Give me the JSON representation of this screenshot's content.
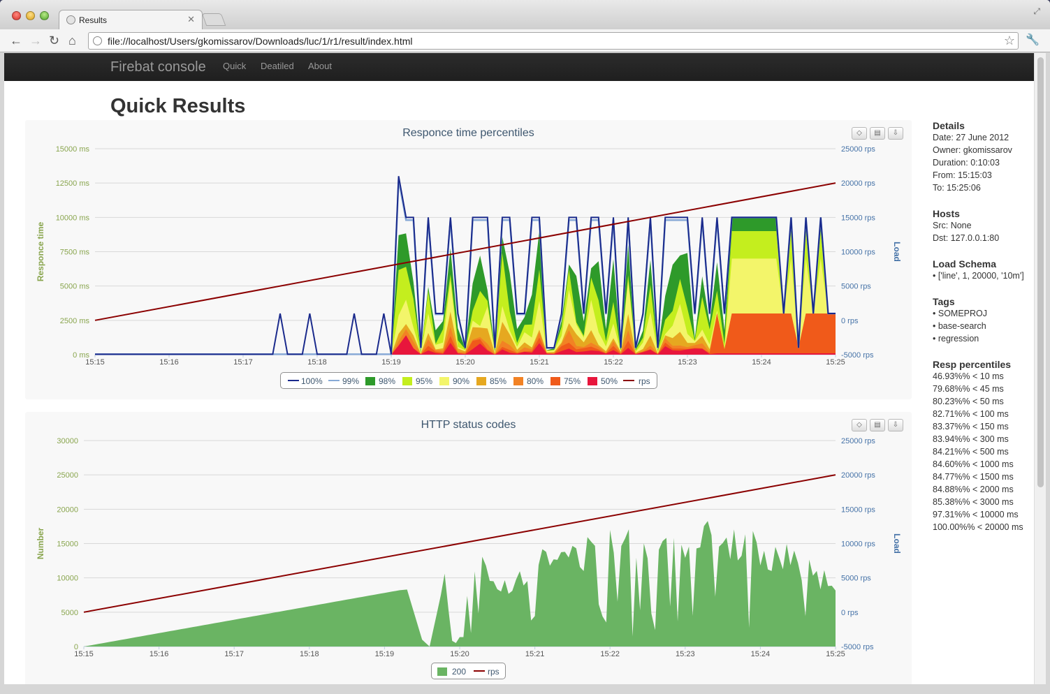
{
  "browser": {
    "tab_title": "Results",
    "url": "file://localhost/Users/gkomissarov/Downloads/luc/1/r1/result/index.html"
  },
  "navbar": {
    "brand": "Firebat console",
    "links": [
      "Quick",
      "Deatiled",
      "About"
    ]
  },
  "page": {
    "title": "Quick Results"
  },
  "sidebar": {
    "details": {
      "heading": "Details",
      "lines": [
        "Date: 27 June 2012",
        "Owner: gkomissarov",
        "Duration: 0:10:03",
        "From: 15:15:03",
        "To: 15:25:06"
      ]
    },
    "hosts": {
      "heading": "Hosts",
      "lines": [
        "Src: None",
        "Dst: 127.0.0.1:80"
      ]
    },
    "load_schema": {
      "heading": "Load Schema",
      "items": [
        "['line', 1, 20000, '10m']"
      ]
    },
    "tags": {
      "heading": "Tags",
      "items": [
        "SOMEPROJ",
        "base-search",
        "regression"
      ]
    },
    "resp_percentiles": {
      "heading": "Resp percentiles",
      "lines": [
        "46.93%% < 10 ms",
        "79.68%% < 45 ms",
        "80.23%% < 50 ms",
        "82.71%% < 100 ms",
        "83.37%% < 150 ms",
        "83.94%% < 300 ms",
        "84.21%% < 500 ms",
        "84.60%% < 1000 ms",
        "84.77%% < 1500 ms",
        "84.88%% < 2000 ms",
        "85.38%% < 3000 ms",
        "97.31%% < 10000 ms",
        "100.00%% < 20000 ms"
      ]
    }
  },
  "chart_data": [
    {
      "type": "area",
      "title": "Responce time percentiles",
      "ylabel": "Responce time",
      "y2label": "Load",
      "ylim": [
        0,
        15000
      ],
      "y2lim": [
        -5000,
        25000
      ],
      "y_ticks": [
        "0 ms",
        "2500 ms",
        "5000 ms",
        "7500 ms",
        "10000 ms",
        "12500 ms",
        "15000 ms"
      ],
      "y2_ticks": [
        "-5000 rps",
        "0 rps",
        "5000 rps",
        "10000 rps",
        "15000 rps",
        "20000 rps",
        "25000 rps"
      ],
      "x_ticks": [
        "15:15",
        "15:16",
        "15:17",
        "15:18",
        "15:19",
        "15:20",
        "15:21",
        "15:22",
        "15:23",
        "15:24",
        "15:25"
      ],
      "legend": [
        "100%",
        "99%",
        "98%",
        "95%",
        "90%",
        "85%",
        "80%",
        "75%",
        "50%",
        "rps"
      ],
      "colors": {
        "100%": "#1a2a8c",
        "99%": "#87a9d6",
        "98%": "#2e9a2a",
        "95%": "#c4ee1e",
        "90%": "#f3f56a",
        "85%": "#e6a820",
        "80%": "#f28224",
        "75%": "#f05a1a",
        "50%": "#e8163c",
        "rps": "#8b0000"
      },
      "series": [
        {
          "name": "100%",
          "points": [
            [
              0,
              0
            ],
            [
              0.5,
              0
            ],
            [
              1,
              0
            ],
            [
              2,
              0
            ],
            [
              2.4,
              0
            ],
            [
              2.5,
              0
            ],
            [
              2.6,
              0
            ],
            [
              2.7,
              0
            ],
            [
              2.8,
              0
            ],
            [
              2.9,
              0
            ],
            [
              3.0,
              0
            ],
            [
              3.1,
              0
            ],
            [
              3.2,
              0
            ],
            [
              3.3,
              0
            ],
            [
              3.4,
              0
            ],
            [
              3.5,
              0
            ],
            [
              3.6,
              0
            ],
            [
              3.7,
              0
            ],
            [
              3.8,
              0
            ],
            [
              3.9,
              0
            ],
            [
              4.0,
              0
            ],
            [
              4.1,
              0
            ],
            [
              4.2,
              0
            ],
            [
              4.3,
              0
            ],
            [
              4.4,
              0
            ],
            [
              4.5,
              0
            ],
            [
              4.6,
              0
            ],
            [
              4.7,
              0
            ],
            [
              4.8,
              0
            ],
            [
              4.9,
              0
            ],
            [
              5.0,
              0
            ],
            [
              5.1,
              0
            ],
            [
              5.2,
              0
            ],
            [
              5.3,
              0
            ],
            [
              5.4,
              0
            ],
            [
              5.5,
              0
            ],
            [
              5.6,
              0
            ],
            [
              5.7,
              0
            ],
            [
              5.8,
              0
            ],
            [
              5.9,
              0
            ],
            [
              6.0,
              0
            ],
            [
              6.1,
              0
            ],
            [
              6.2,
              0
            ],
            [
              6.3,
              0
            ],
            [
              6.4,
              0
            ],
            [
              6.5,
              0
            ],
            [
              6.6,
              0
            ],
            [
              6.7,
              0
            ],
            [
              6.8,
              0
            ],
            [
              6.9,
              0
            ],
            [
              7.0,
              0
            ],
            [
              7.1,
              0
            ],
            [
              7.2,
              0
            ],
            [
              7.3,
              0
            ],
            [
              7.4,
              0
            ],
            [
              7.5,
              0
            ],
            [
              7.6,
              0
            ],
            [
              7.7,
              0
            ],
            [
              7.8,
              0
            ],
            [
              7.9,
              0
            ],
            [
              8.0,
              0
            ],
            [
              8.1,
              0
            ],
            [
              8.2,
              0
            ],
            [
              8.3,
              0
            ],
            [
              8.4,
              0
            ],
            [
              8.5,
              0
            ],
            [
              8.6,
              0
            ],
            [
              8.7,
              0
            ],
            [
              8.8,
              0
            ],
            [
              8.9,
              0
            ],
            [
              9.0,
              0
            ],
            [
              9.1,
              0
            ],
            [
              9.2,
              0
            ],
            [
              9.3,
              0
            ],
            [
              9.4,
              0
            ],
            [
              9.5,
              0
            ],
            [
              9.6,
              0
            ],
            [
              9.7,
              0
            ],
            [
              9.8,
              0
            ],
            [
              9.9,
              0
            ],
            [
              10.0,
              0
            ]
          ]
        },
        {
          "name": "rps",
          "points": [
            [
              0,
              1
            ],
            [
              10,
              20000
            ]
          ]
        }
      ]
    },
    {
      "type": "area",
      "title": "HTTP status codes",
      "ylabel": "Number",
      "y2label": "Load",
      "ylim": [
        0,
        30000
      ],
      "y2lim": [
        -5000,
        25000
      ],
      "y_ticks": [
        "0",
        "5000",
        "10000",
        "15000",
        "20000",
        "25000",
        "30000"
      ],
      "y2_ticks": [
        "-5000 rps",
        "0 rps",
        "5000 rps",
        "10000 rps",
        "15000 rps",
        "20000 rps",
        "25000 rps"
      ],
      "x_ticks": [
        "15:15",
        "15:16",
        "15:17",
        "15:18",
        "15:19",
        "15:20",
        "15:21",
        "15:22",
        "15:23",
        "15:24",
        "15:25"
      ],
      "legend": [
        "200",
        "rps"
      ],
      "colors": {
        "200": "#6ab463",
        "rps": "#8b0000"
      },
      "series": [
        {
          "name": "200",
          "points": [
            [
              0,
              0
            ],
            [
              4.2,
              8200
            ],
            [
              4.3,
              8300
            ],
            [
              4.5,
              1000
            ],
            [
              4.6,
              0
            ],
            [
              4.8,
              10000
            ],
            [
              4.95,
              600
            ],
            [
              5.2,
              14000
            ],
            [
              5.5,
              9000
            ],
            [
              6.0,
              13000
            ],
            [
              7.0,
              15500
            ],
            [
              8.0,
              16500
            ],
            [
              8.5,
              17000
            ],
            [
              9.0,
              15000
            ],
            [
              9.5,
              13000
            ],
            [
              10.0,
              9800
            ]
          ]
        },
        {
          "name": "rps",
          "points": [
            [
              0,
              1
            ],
            [
              10,
              20000
            ]
          ]
        }
      ]
    }
  ]
}
